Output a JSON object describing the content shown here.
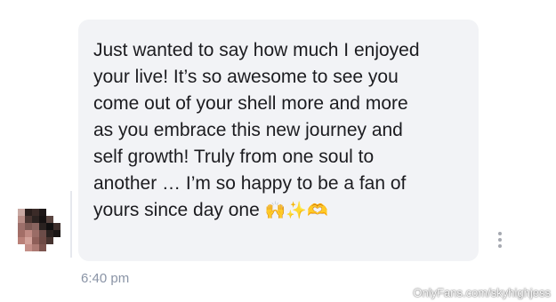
{
  "message": {
    "lines": [
      "Just wanted to say how much I enjoyed",
      "your live! It’s so awesome to see you",
      "come out of your shell more and more",
      "as you embrace this new journey and",
      "self growth! Truly from one soul to",
      "another … I’m so happy to be a fan of",
      "yours since day one"
    ],
    "emojis": [
      "🙌",
      "✨",
      "🫶"
    ],
    "timestamp": "6:40 pm"
  },
  "sender": {
    "avatar_icon": "pixelated-avatar"
  },
  "menu": {
    "icon": "more-vertical-icon"
  },
  "watermark": "OnlyFans.com/skyhighjess",
  "colors": {
    "bubble": "#f2f3f6",
    "text": "#1c1c20",
    "timestamp": "#8a94a6",
    "kebab": "#a6a9b1"
  }
}
